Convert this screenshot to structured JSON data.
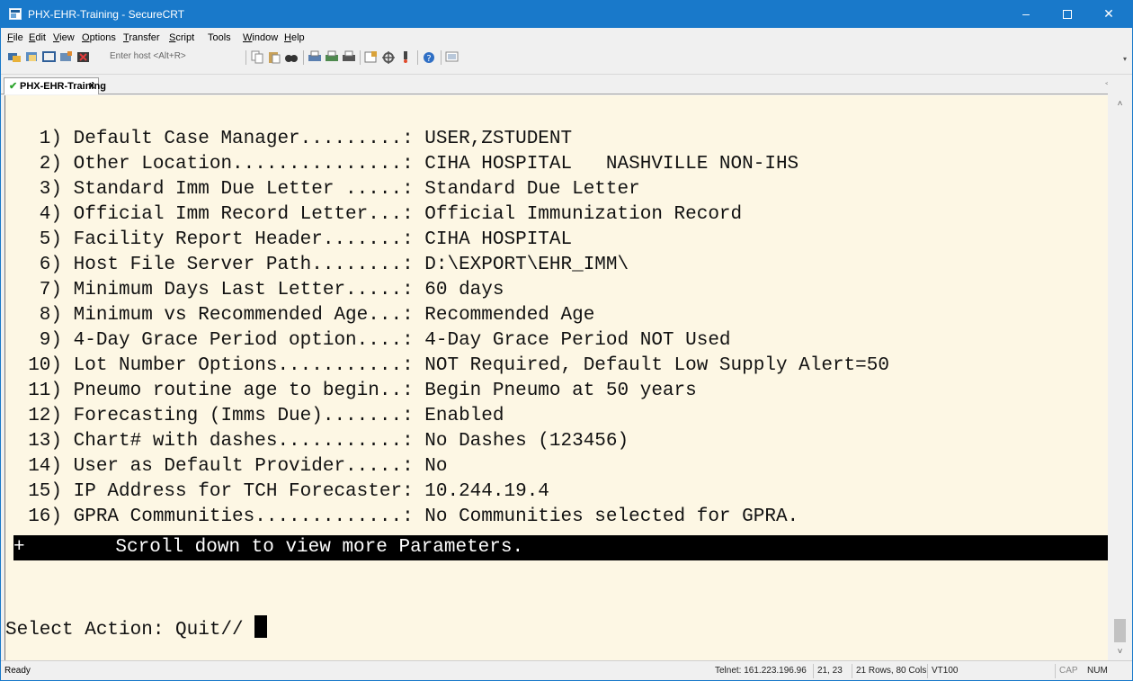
{
  "window": {
    "title": "PHX-EHR-Training - SecureCRT",
    "min_label": "–",
    "max_label": "",
    "close_label": "✕"
  },
  "menu": [
    {
      "label": "File",
      "u": "F",
      "rest": "ile"
    },
    {
      "label": "Edit",
      "u": "E",
      "rest": "dit"
    },
    {
      "label": "View",
      "u": "V",
      "rest": "iew"
    },
    {
      "label": "Options",
      "u": "O",
      "rest": "ptions"
    },
    {
      "label": "Transfer",
      "u": "T",
      "rest": "ransfer"
    },
    {
      "label": "Script",
      "u": "S",
      "rest": "cript"
    },
    {
      "label": "Tools",
      "u": "",
      "rest": "Tools"
    },
    {
      "label": "Window",
      "u": "W",
      "rest": "indow"
    },
    {
      "label": "Help",
      "u": "H",
      "rest": "elp"
    }
  ],
  "toolbar": {
    "host_placeholder": "Enter host <Alt+R>"
  },
  "tab": {
    "label": "PHX-EHR-Training",
    "close": "x",
    "prev": "◁",
    "next": "▷"
  },
  "terminal": {
    "lines": [
      "   1) Default Case Manager.........: USER,ZSTUDENT",
      "   2) Other Location...............: CIHA HOSPITAL   NASHVILLE NON-IHS",
      "   3) Standard Imm Due Letter .....: Standard Due Letter",
      "   4) Official Imm Record Letter...: Official Immunization Record",
      "   5) Facility Report Header.......: CIHA HOSPITAL",
      "   6) Host File Server Path........: D:\\EXPORT\\EHR_IMM\\",
      "   7) Minimum Days Last Letter.....: 60 days",
      "   8) Minimum vs Recommended Age...: Recommended Age",
      "   9) 4-Day Grace Period option....: 4-Day Grace Period NOT Used",
      "  10) Lot Number Options...........: NOT Required, Default Low Supply Alert=50",
      "  11) Pneumo routine age to begin..: Begin Pneumo at 50 years",
      "  12) Forecasting (Imms Due).......: Enabled",
      "  13) Chart# with dashes...........: No Dashes (123456)",
      "  14) User as Default Provider.....: No",
      "  15) IP Address for TCH Forecaster: 10.244.19.4",
      "  16) GPRA Communities.............: No Communities selected for GPRA."
    ],
    "scroll_hint": "+        Scroll down to view more Parameters.",
    "prompt": "Select Action: Quit// "
  },
  "status": {
    "ready": "Ready",
    "connection": "Telnet: 161.223.196.96",
    "position": "21, 23",
    "size": "21 Rows, 80 Cols",
    "emulation": "VT100",
    "cap": "CAP",
    "num": "NUM"
  }
}
